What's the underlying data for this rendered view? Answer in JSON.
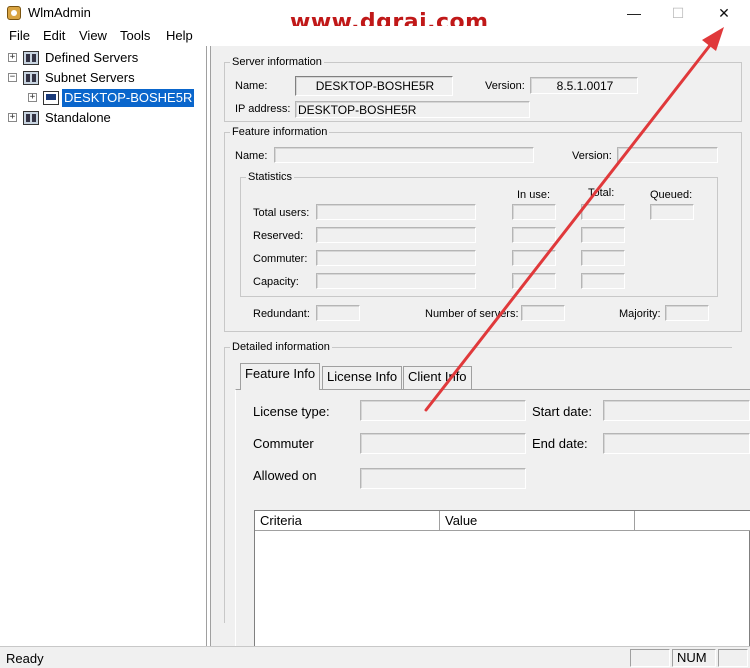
{
  "window": {
    "title": "WlmAdmin",
    "watermark": "www.dgrai.com",
    "minimize": "—",
    "maximize": "☐",
    "close": "✕"
  },
  "menu": [
    "File",
    "Edit",
    "View",
    "Tools",
    "Help"
  ],
  "tree": {
    "items": [
      "Defined Servers",
      "Subnet Servers",
      "DESKTOP-BOSHE5R",
      "Standalone"
    ],
    "expanders": [
      "+",
      "−",
      "+",
      "+"
    ]
  },
  "server_info": {
    "title": "Server information",
    "name_label": "Name:",
    "name": "DESKTOP-BOSHE5R",
    "version_label": "Version:",
    "version": "8.5.1.0017",
    "ip_label": "IP address:",
    "ip": "DESKTOP-BOSHE5R"
  },
  "feature_info": {
    "title": "Feature information",
    "name_label": "Name:",
    "version_label": "Version:",
    "statistics": {
      "title": "Statistics",
      "in_use": "In use:",
      "total": "Total:",
      "queued": "Queued:",
      "rows": [
        "Total users:",
        "Reserved:",
        "Commuter:",
        "Capacity:"
      ]
    },
    "redundant_label": "Redundant:",
    "num_servers_label": "Number of servers:",
    "majority_label": "Majority:"
  },
  "detailed": {
    "title": "Detailed information",
    "tabs": [
      "Feature Info",
      "License Info",
      "Client Info"
    ],
    "license_type": "License type:",
    "start_date": "Start date:",
    "commuter": "Commuter",
    "end_date": "End date:",
    "allowed_on": "Allowed on",
    "columns": [
      "Criteria",
      "Value"
    ]
  },
  "status": {
    "text": "Ready",
    "num": "NUM"
  },
  "colors": {
    "selection": "#0a66cc",
    "arrow": "#e0393b",
    "watermark": "#c01818"
  }
}
